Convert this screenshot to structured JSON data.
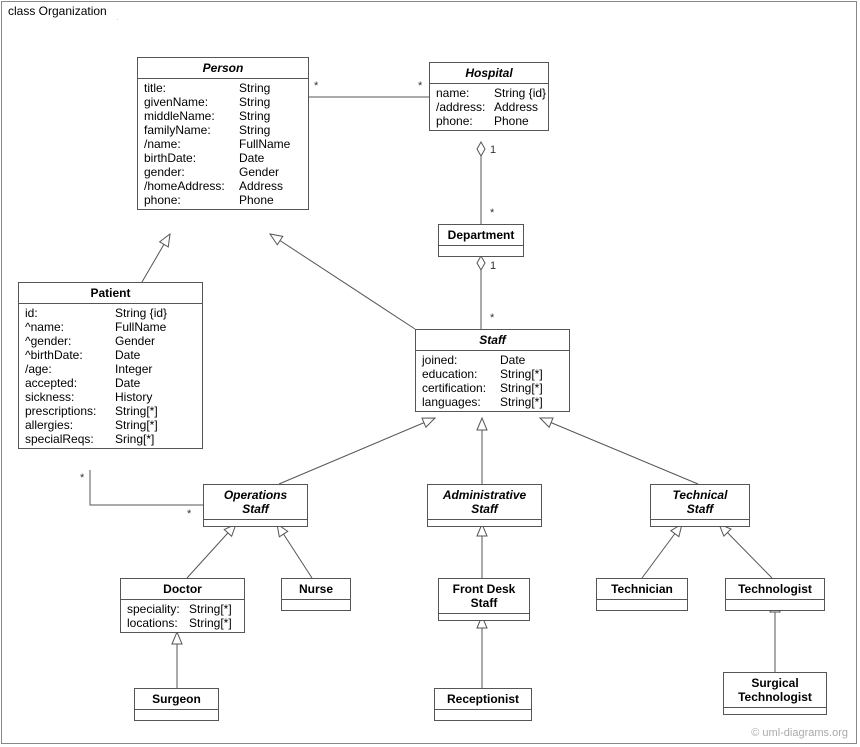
{
  "frame": {
    "title": "class Organization"
  },
  "watermark": "© uml-diagrams.org",
  "classes": {
    "person": {
      "name": "Person",
      "attrs": [
        {
          "n": "title:",
          "t": "String"
        },
        {
          "n": "givenName:",
          "t": "String"
        },
        {
          "n": "middleName:",
          "t": "String"
        },
        {
          "n": "familyName:",
          "t": "String"
        },
        {
          "n": "/name:",
          "t": "FullName"
        },
        {
          "n": "birthDate:",
          "t": "Date"
        },
        {
          "n": "gender:",
          "t": "Gender"
        },
        {
          "n": "/homeAddress:",
          "t": "Address"
        },
        {
          "n": "phone:",
          "t": "Phone"
        }
      ]
    },
    "hospital": {
      "name": "Hospital",
      "attrs": [
        {
          "n": "name:",
          "t": "String {id}"
        },
        {
          "n": "/address:",
          "t": "Address"
        },
        {
          "n": "phone:",
          "t": "Phone"
        }
      ]
    },
    "department": {
      "name": "Department"
    },
    "patient": {
      "name": "Patient",
      "attrs": [
        {
          "n": "id:",
          "t": "String {id}"
        },
        {
          "n": "^name:",
          "t": "FullName"
        },
        {
          "n": "^gender:",
          "t": "Gender"
        },
        {
          "n": "^birthDate:",
          "t": "Date"
        },
        {
          "n": "/age:",
          "t": "Integer"
        },
        {
          "n": "accepted:",
          "t": "Date"
        },
        {
          "n": "sickness:",
          "t": "History"
        },
        {
          "n": "prescriptions:",
          "t": "String[*]"
        },
        {
          "n": "allergies:",
          "t": "String[*]"
        },
        {
          "n": "specialReqs:",
          "t": "Sring[*]"
        }
      ]
    },
    "staff": {
      "name": "Staff",
      "attrs": [
        {
          "n": "joined:",
          "t": "Date"
        },
        {
          "n": "education:",
          "t": "String[*]"
        },
        {
          "n": "certification:",
          "t": "String[*]"
        },
        {
          "n": "languages:",
          "t": "String[*]"
        }
      ]
    },
    "opsStaff": {
      "name": "Operations",
      "name2": "Staff"
    },
    "adminStaff": {
      "name": "Administrative",
      "name2": "Staff"
    },
    "techStaff": {
      "name": "Technical",
      "name2": "Staff"
    },
    "doctor": {
      "name": "Doctor",
      "attrs": [
        {
          "n": "speciality:",
          "t": "String[*]"
        },
        {
          "n": "locations:",
          "t": "String[*]"
        }
      ]
    },
    "nurse": {
      "name": "Nurse"
    },
    "frontDesk": {
      "name": "Front Desk",
      "name2": "Staff"
    },
    "technician": {
      "name": "Technician"
    },
    "technologist": {
      "name": "Technologist"
    },
    "surgeon": {
      "name": "Surgeon"
    },
    "receptionist": {
      "name": "Receptionist"
    },
    "surgTech": {
      "name": "Surgical",
      "name2": "Technologist"
    }
  },
  "mult": {
    "personHospL": "*",
    "personHospR": "*",
    "hospDept1": "1",
    "hospDeptStar": "*",
    "deptStaff1": "1",
    "deptStaffStar": "*",
    "patientOpsL": "*",
    "patientOpsR": "*"
  }
}
